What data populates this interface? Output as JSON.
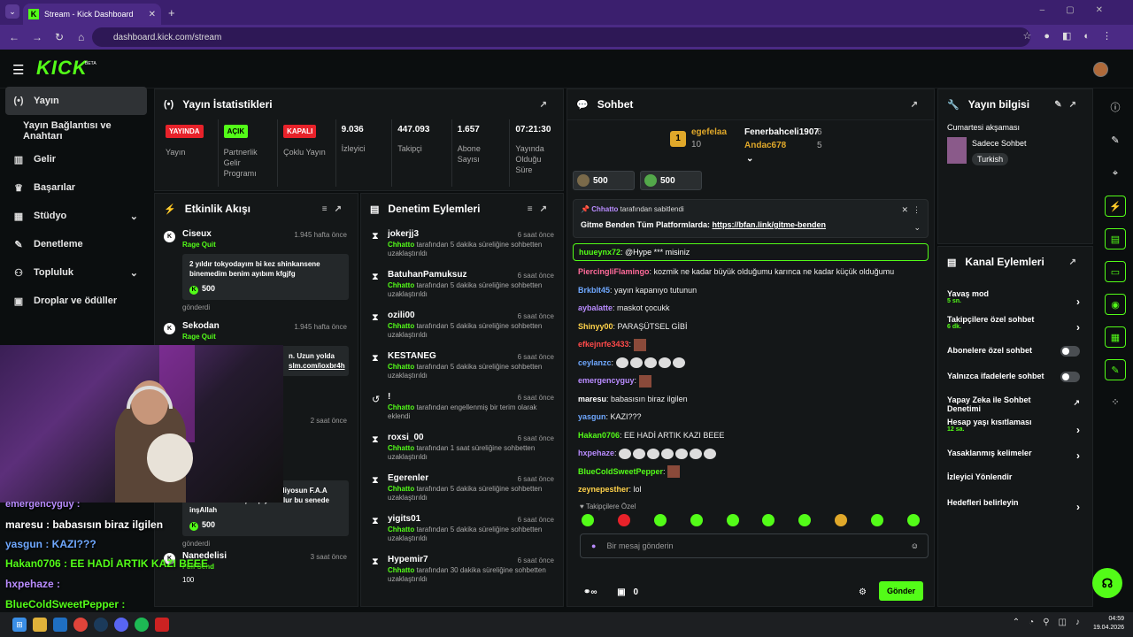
{
  "browser": {
    "tab_title": "Stream - Kick Dashboard",
    "url": "dashboard.kick.com/stream"
  },
  "header": {
    "logo": "KICK",
    "beta": "BETA"
  },
  "sidebar": {
    "items": [
      {
        "label": "Yayın",
        "icon": "broadcast-icon"
      },
      {
        "label": "Yayın Bağlantısı ve Anahtarı",
        "icon": ""
      },
      {
        "label": "Gelir",
        "icon": "revenue-icon"
      },
      {
        "label": "Başarılar",
        "icon": "trophy-icon"
      },
      {
        "label": "Stüdyo",
        "icon": "studio-icon"
      },
      {
        "label": "Denetleme",
        "icon": "wrench-icon"
      },
      {
        "label": "Topluluk",
        "icon": "community-icon"
      },
      {
        "label": "Droplar ve ödüller",
        "icon": "gift-icon"
      }
    ]
  },
  "stats": {
    "title": "Yayın İstatistikleri",
    "items": [
      {
        "badge": "YAYINDA",
        "badge_color": "#e8222a",
        "label": "Yayın"
      },
      {
        "badge": "AÇIK",
        "badge_color": "#53fc18",
        "label": "Partnerlik Gelir Programı"
      },
      {
        "badge": "KAPALI",
        "badge_color": "#e8222a",
        "label": "Çoklu Yayın"
      },
      {
        "value": "9.036",
        "label": "İzleyici"
      },
      {
        "value": "447.093",
        "label": "Takipçi"
      },
      {
        "value": "1.657",
        "label": "Abone Sayısı"
      },
      {
        "value": "07:21:30",
        "label": "Yayında Olduğu Süre"
      }
    ]
  },
  "activity": {
    "title": "Etkinlik Akışı",
    "items": [
      {
        "name": "Ciseux",
        "time": "1.945 hafta önce",
        "event": "Rage Quit",
        "message": "2 yıldır tokyodayım bi kez shinkansene binemedim benim ayıbım kfgjfg",
        "kicks": "500",
        "sent": "gönderdi"
      },
      {
        "name": "Sekodan",
        "time": "1.945 hafta önce",
        "event": "Rage Quit",
        "message_tail1": "n. Uzun yolda",
        "message_tail2": "slm.com/ioxbr4h"
      },
      {
        "time": "2 saat önce"
      },
      {
        "message": "Abi suriyeden salamlar seviliyosun F.A.A GALATASARAY şampiyon olur bu senede inşAllah",
        "kicks": "500",
        "sent": "gönderdi"
      },
      {
        "name": "Nanedelisi",
        "time": "3 saat önce",
        "event": "Full Send",
        "kicks": "100"
      }
    ]
  },
  "moderation": {
    "title": "Denetim Eylemleri",
    "items": [
      {
        "name": "jokerjj3",
        "time": "6 saat önce",
        "actor": "Chhatto",
        "desc": "tarafından 5 dakika süreliğine sohbetten uzaklaştırıldı"
      },
      {
        "name": "BatuhanPamuksuz",
        "time": "6 saat önce",
        "actor": "Chhatto",
        "desc": "tarafından 5 dakika süreliğine sohbetten uzaklaştırıldı"
      },
      {
        "name": "ozili00",
        "time": "6 saat önce",
        "actor": "Chhatto",
        "desc": "tarafından 5 dakika süreliğine sohbetten uzaklaştırıldı"
      },
      {
        "name": "KESTANEG",
        "time": "6 saat önce",
        "actor": "Chhatto",
        "desc": "tarafından 5 dakika süreliğine sohbetten uzaklaştırıldı"
      },
      {
        "name": "!",
        "time": "6 saat önce",
        "actor": "Chhatto",
        "desc": "tarafından engellenmiş bir terim olarak eklendi"
      },
      {
        "name": "roxsi_00",
        "time": "6 saat önce",
        "actor": "Chhatto",
        "desc": "tarafından 1 saat süreliğine sohbetten uzaklaştırıldı"
      },
      {
        "name": "Egerenler",
        "time": "6 saat önce",
        "actor": "Chhatto",
        "desc": "tarafından 5 dakika süreliğine sohbetten uzaklaştırıldı"
      },
      {
        "name": "yigits01",
        "time": "6 saat önce",
        "actor": "Chhatto",
        "desc": "tarafından 5 dakika süreliğine sohbetten uzaklaştırıldı"
      },
      {
        "name": "Hypemir7",
        "time": "6 saat önce",
        "actor": "Chhatto",
        "desc": "tarafından 30 dakika süreliğine sohbetten uzaklaştırıldı"
      }
    ]
  },
  "chat": {
    "title": "Sohbet",
    "leader1": {
      "rank": "1",
      "name": "egefelaa",
      "count": "10"
    },
    "leader2": {
      "name": "Fenerbahceli1907",
      "count": "6"
    },
    "leader3": {
      "name": "Andac678",
      "count": "5"
    },
    "gifts": [
      "500",
      "500"
    ],
    "pinned": {
      "by": "Chhatto",
      "by_text": "tarafından sabitlendi",
      "text": "Gitme Benden Tüm Platformlarda:",
      "link": "https://bfan.link/gitme-benden"
    },
    "highlight": {
      "user": "huueynx72",
      "text": ": @Hype *** misiniz"
    },
    "messages": [
      {
        "user": "PiercingliFlamingo",
        "color": "#ff6b9a",
        "text": ": kozmik ne kadar büyük olduğumu karınca ne kadar küçük olduğumu"
      },
      {
        "user": "Brkblt45",
        "color": "#6fa8ff",
        "text": ": yayın kapanıyo tutunun"
      },
      {
        "user": "aybalatte",
        "color": "#b98cff",
        "text": ": maskot çocukk"
      },
      {
        "user": "Shinyy00",
        "color": "#ffd24a",
        "text": ": PARAŞÜTSEL GİBİ"
      },
      {
        "user": "efkejnrfe3433",
        "color": "#ff4a4a",
        "text": ":"
      },
      {
        "user": "ceylanzc",
        "color": "#6fa8ff",
        "text": ":"
      },
      {
        "user": "emergencyguy",
        "color": "#b98cff",
        "text": ":"
      },
      {
        "user": "maresu",
        "color": "#ffffff",
        "text": ": babasısın biraz ilgilen"
      },
      {
        "user": "yasgun",
        "color": "#6fa8ff",
        "text": ": KAZI???"
      },
      {
        "user": "Hakan0706",
        "color": "#53fc18",
        "text": ": EE HADİ ARTIK KAZI BEEE"
      },
      {
        "user": "hxpehaze",
        "color": "#b98cff",
        "text": ":"
      },
      {
        "user": "BlueColdSweetPepper",
        "color": "#53fc18",
        "text": ":"
      },
      {
        "user": "zeynepesther",
        "color": "#ffd24a",
        "text": ": lol"
      }
    ],
    "followers_only": "Takipçilere Özel",
    "placeholder": "Bir mesaj gönderin",
    "count": "0",
    "send": "Gönder"
  },
  "info": {
    "title": "Yayın bilgisi",
    "stream_title": "Cumartesi akşaması",
    "category": "Sadece Sohbet",
    "tag": "Turkish"
  },
  "channel": {
    "title": "Kanal Eylemleri",
    "items": [
      {
        "label": "Yavaş mod",
        "sub": "5 sn."
      },
      {
        "label": "Takipçilere özel sohbet",
        "sub": "6 dk."
      },
      {
        "label": "Abonelere özel sohbet"
      },
      {
        "label": "Yalnızca ifadelerle sohbet"
      },
      {
        "label": "Yapay Zeka ile Sohbet Denetimi"
      },
      {
        "label": "Hesap yaşı kısıtlaması",
        "sub": "12 sa."
      },
      {
        "label": "Yasaklanmış kelimeler"
      },
      {
        "label": "İzleyici Yönlendir"
      },
      {
        "label": "Hedefleri belirleyin"
      }
    ]
  },
  "overlay": {
    "lines": [
      {
        "text": "emergencyguy :",
        "color": "#b98cff"
      },
      {
        "text": "maresu : babasısın biraz ilgilen",
        "color": "#ffffff"
      },
      {
        "text": "yasgun : KAZI???",
        "color": "#6fa8ff"
      },
      {
        "text": "Hakan0706 : EE HADİ ARTIK KAZI BEEE",
        "color": "#53fc18"
      },
      {
        "text": "hxpehaze :",
        "color": "#b98cff"
      },
      {
        "text": "BlueColdSweetPepper :",
        "color": "#53fc18"
      }
    ]
  },
  "taskbar": {
    "time": "04:59",
    "date": "19.04.2026"
  }
}
